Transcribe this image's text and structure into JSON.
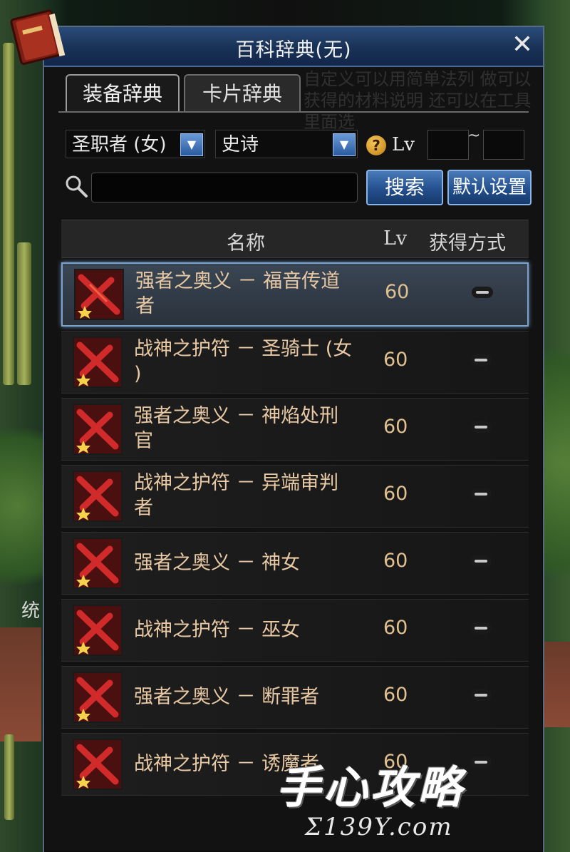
{
  "window": {
    "title": "百科辞典(无)",
    "close_label": "✕"
  },
  "tabs": [
    {
      "label": "装备辞典",
      "active": true
    },
    {
      "label": "卡片辞典",
      "active": false
    }
  ],
  "background_text": "自定义可以用简单法列 做可以获得的材料说明 还可以在工具里面选",
  "filters": {
    "class_value": "圣职者 (女)",
    "rarity_value": "史诗",
    "help_label": "?",
    "lv_label": "Lv",
    "lv_min": "",
    "lv_max": "",
    "lv_separator": "~"
  },
  "search": {
    "value": "",
    "search_button": "搜索",
    "default_button": "默认设置"
  },
  "table": {
    "columns": {
      "name": "名称",
      "lv": "Lv",
      "source": "获得方式"
    },
    "rows": [
      {
        "name_line1": "强者之奥义 － 福音传道",
        "name_line2": "者",
        "lv": "60",
        "selected": true
      },
      {
        "name_line1": "战神之护符 － 圣骑士 (女",
        "name_line2": ")",
        "lv": "60",
        "selected": false
      },
      {
        "name_line1": "强者之奥义 － 神焰处刑",
        "name_line2": "官",
        "lv": "60",
        "selected": false
      },
      {
        "name_line1": "战神之护符 － 异端审判",
        "name_line2": "者",
        "lv": "60",
        "selected": false
      },
      {
        "name_line1": "强者之奥义 － 神女",
        "name_line2": "",
        "lv": "60",
        "selected": false
      },
      {
        "name_line1": "战神之护符 － 巫女",
        "name_line2": "",
        "lv": "60",
        "selected": false
      },
      {
        "name_line1": "强者之奥义 － 断罪者",
        "name_line2": "",
        "lv": "60",
        "selected": false
      },
      {
        "name_line1": "战神之护符 － 诱魔者",
        "name_line2": "",
        "lv": "60",
        "selected": false
      }
    ]
  },
  "side_text": "统",
  "watermark": {
    "main": "手心攻略",
    "sub": "Σ139Y.com"
  },
  "colors": {
    "title_bar": "#1a3358",
    "item_name": "#e8c9a4",
    "button_blue": "#24508e",
    "selected_border": "#7aa2cc"
  }
}
